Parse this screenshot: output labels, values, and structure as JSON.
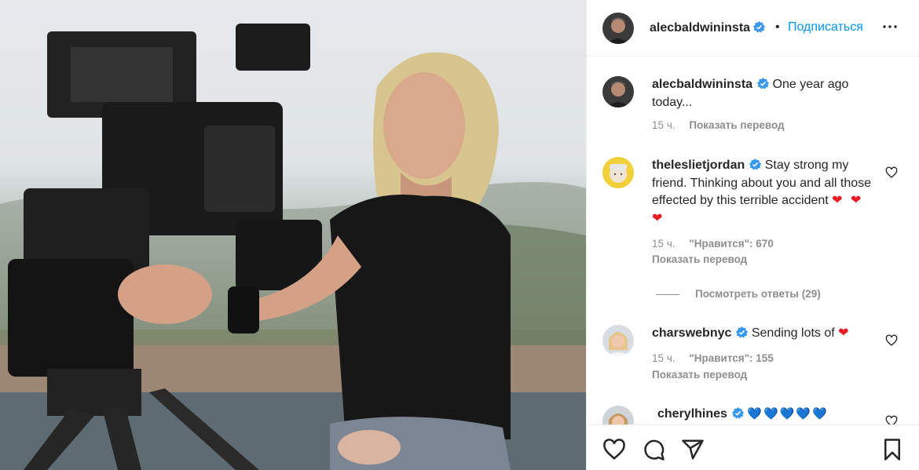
{
  "post": {
    "author": "alecbaldwininsta",
    "follow_label": "Подписаться",
    "separator": "•",
    "more_label": "•••"
  },
  "caption": {
    "username": "alecbaldwininsta",
    "text": "One year ago today...",
    "time": "15 ч.",
    "translate_label": "Показать перевод"
  },
  "comments": [
    {
      "username": "theleslietjordan",
      "text": "Stay strong my friend. Thinking about you and all those effected by this terrible accident",
      "emoji": "❤ ❤ ❤",
      "time": "15 ч.",
      "likes_label": "\"Нравится\": 670",
      "translate_label": "Показать перевод",
      "replies_label": "Посмотреть ответы (29)"
    },
    {
      "username": "charswebnyc",
      "text": "Sending lots of",
      "emoji": "❤",
      "time": "15 ч.",
      "likes_label": "\"Нравится\": 155",
      "translate_label": "Показать перевод"
    },
    {
      "username": "cherylhines",
      "emoji": "💙💙💙💙💙"
    }
  ],
  "icons": {
    "verified": "verified-badge-icon",
    "like": "heart-icon",
    "comment": "comment-icon",
    "share": "paper-plane-icon",
    "save": "bookmark-icon"
  },
  "colors": {
    "accent": "#0095f6",
    "verified": "#3897f0",
    "muted": "#8e8e8e",
    "red_heart": "#ed1c24",
    "blue_heart": "#0a64d8"
  }
}
